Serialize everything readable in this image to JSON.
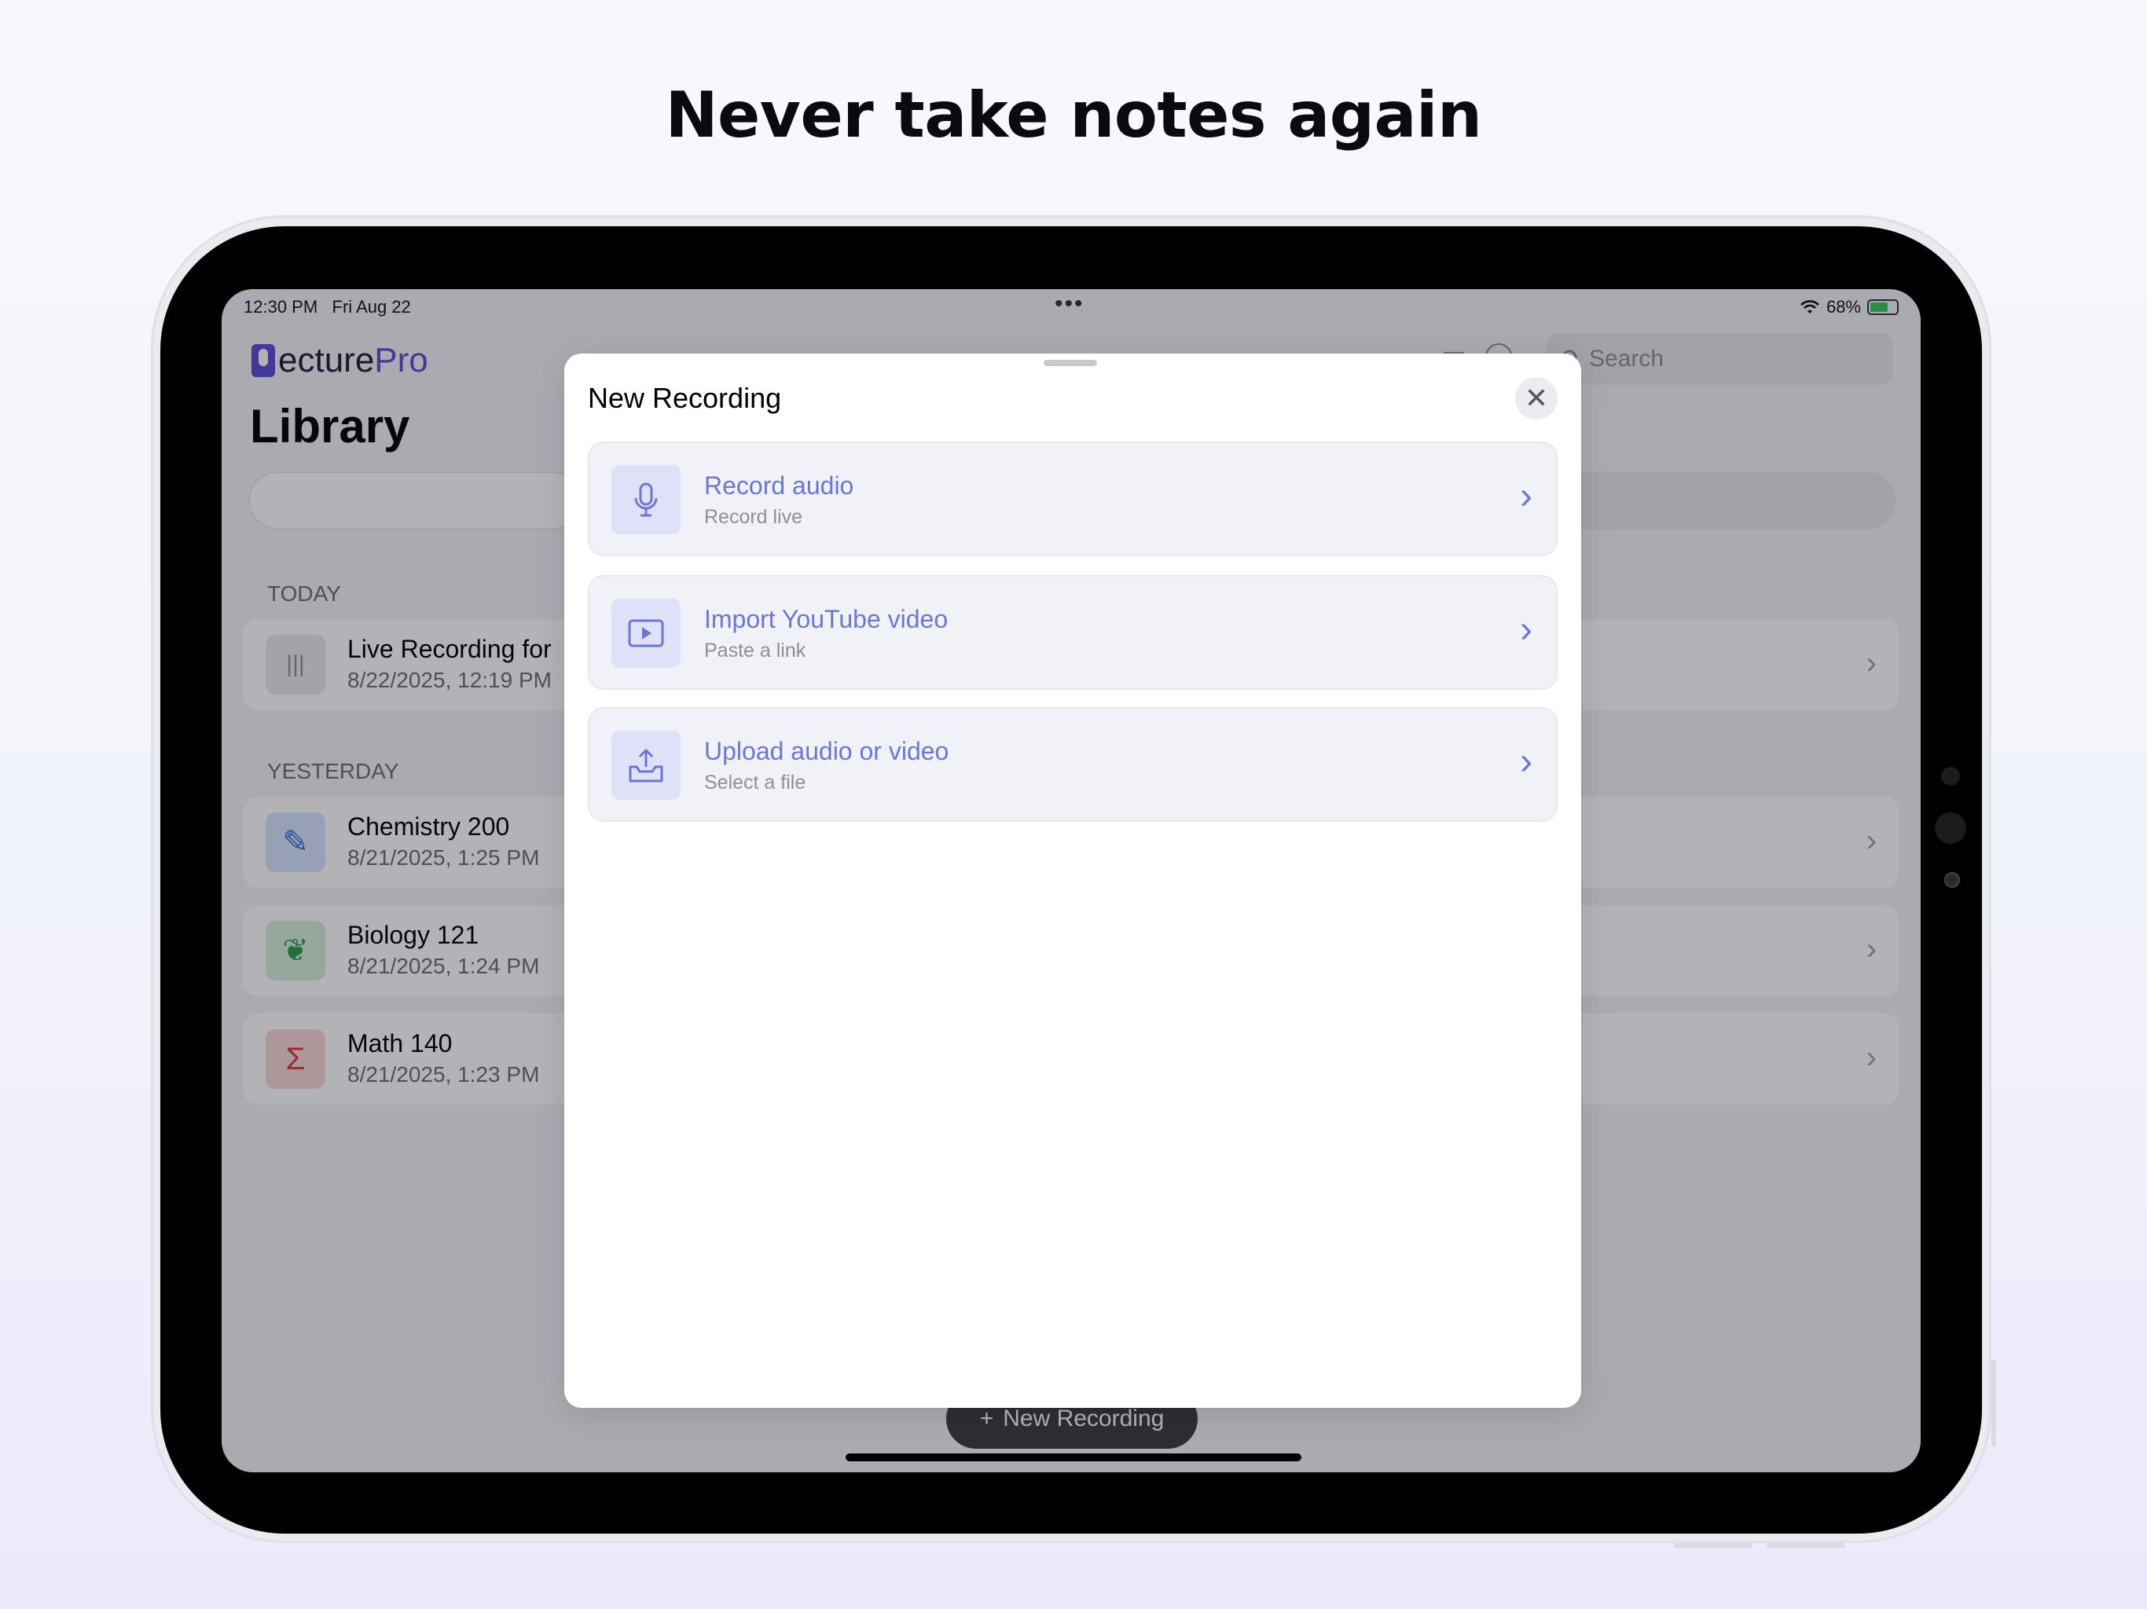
{
  "headline": "Never take notes again",
  "status_bar": {
    "time": "12:30 PM",
    "date": "Fri Aug 22",
    "dots": "•••",
    "battery": "68%"
  },
  "app": {
    "logo_prefix": "ecture",
    "logo_suffix": "Pro",
    "page_title": "Library",
    "search_placeholder": "Search"
  },
  "sections": [
    {
      "label": "TODAY",
      "items": [
        {
          "title": "Live Recording for ",
          "subtitle": "8/22/2025, 12:19 PM",
          "icon": "waveform-icon"
        }
      ]
    },
    {
      "label": "YESTERDAY",
      "items": [
        {
          "title": "Chemistry 200",
          "subtitle": "8/21/2025, 1:25 PM",
          "icon": "pipette-icon"
        },
        {
          "title": "Biology 121",
          "subtitle": "8/21/2025, 1:24 PM",
          "icon": "leaf-icon"
        },
        {
          "title": "Math 140",
          "subtitle": "8/21/2025, 1:23 PM",
          "icon": "sigma-icon"
        }
      ]
    }
  ],
  "fab_label": "New Recording",
  "fab_plus": "+",
  "sheet": {
    "title": "New Recording",
    "close": "✕",
    "options": [
      {
        "title": "Record audio",
        "subtitle": "Record live",
        "icon": "microphone-icon"
      },
      {
        "title": "Import YouTube video",
        "subtitle": "Paste a link",
        "icon": "play-icon"
      },
      {
        "title": "Upload audio or video",
        "subtitle": "Select a file",
        "icon": "upload-tray-icon"
      }
    ],
    "chevron": "›"
  },
  "colors": {
    "accent": "#6b76d8",
    "brand": "#5c4bd6",
    "chem_icon": "#2f6fdc",
    "bio_icon": "#2e9b4a",
    "math_icon": "#d43a3a"
  }
}
